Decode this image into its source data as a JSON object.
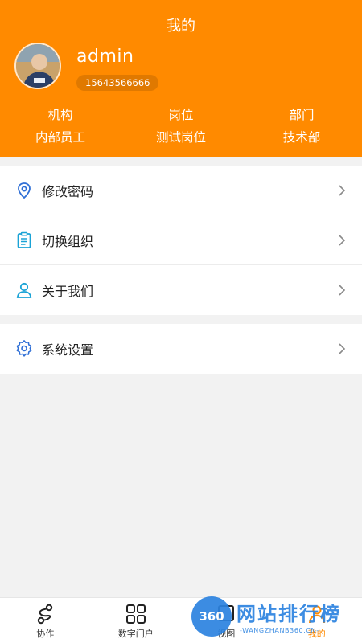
{
  "header": {
    "title": "我的",
    "username": "admin",
    "phone": "15643566666",
    "info": [
      {
        "label": "机构",
        "value": "内部员工"
      },
      {
        "label": "岗位",
        "value": "测试岗位"
      },
      {
        "label": "部门",
        "value": "技术部"
      }
    ]
  },
  "menu": {
    "group1": [
      {
        "label": "修改密码",
        "icon": "location-pin-icon"
      },
      {
        "label": "切换组织",
        "icon": "clipboard-icon"
      },
      {
        "label": "关于我们",
        "icon": "user-icon"
      }
    ],
    "group2": [
      {
        "label": "系统设置",
        "icon": "gear-icon"
      }
    ]
  },
  "tabbar": {
    "tabs": [
      {
        "label": "协作",
        "icon": "share-icon"
      },
      {
        "label": "数字门户",
        "icon": "grid-icon"
      },
      {
        "label": "视图",
        "icon": "view-icon"
      },
      {
        "label": "我的",
        "icon": "person-icon"
      }
    ]
  },
  "watermark": {
    "badge": "360",
    "title": "网站排行榜",
    "subtitle": "-WANGZHANB360.CN-"
  },
  "colors": {
    "accent": "#ff8a00",
    "icon_blue": "#2f6fd6",
    "icon_cyan": "#1aa3d6",
    "watermark_blue": "#2c83e0"
  }
}
